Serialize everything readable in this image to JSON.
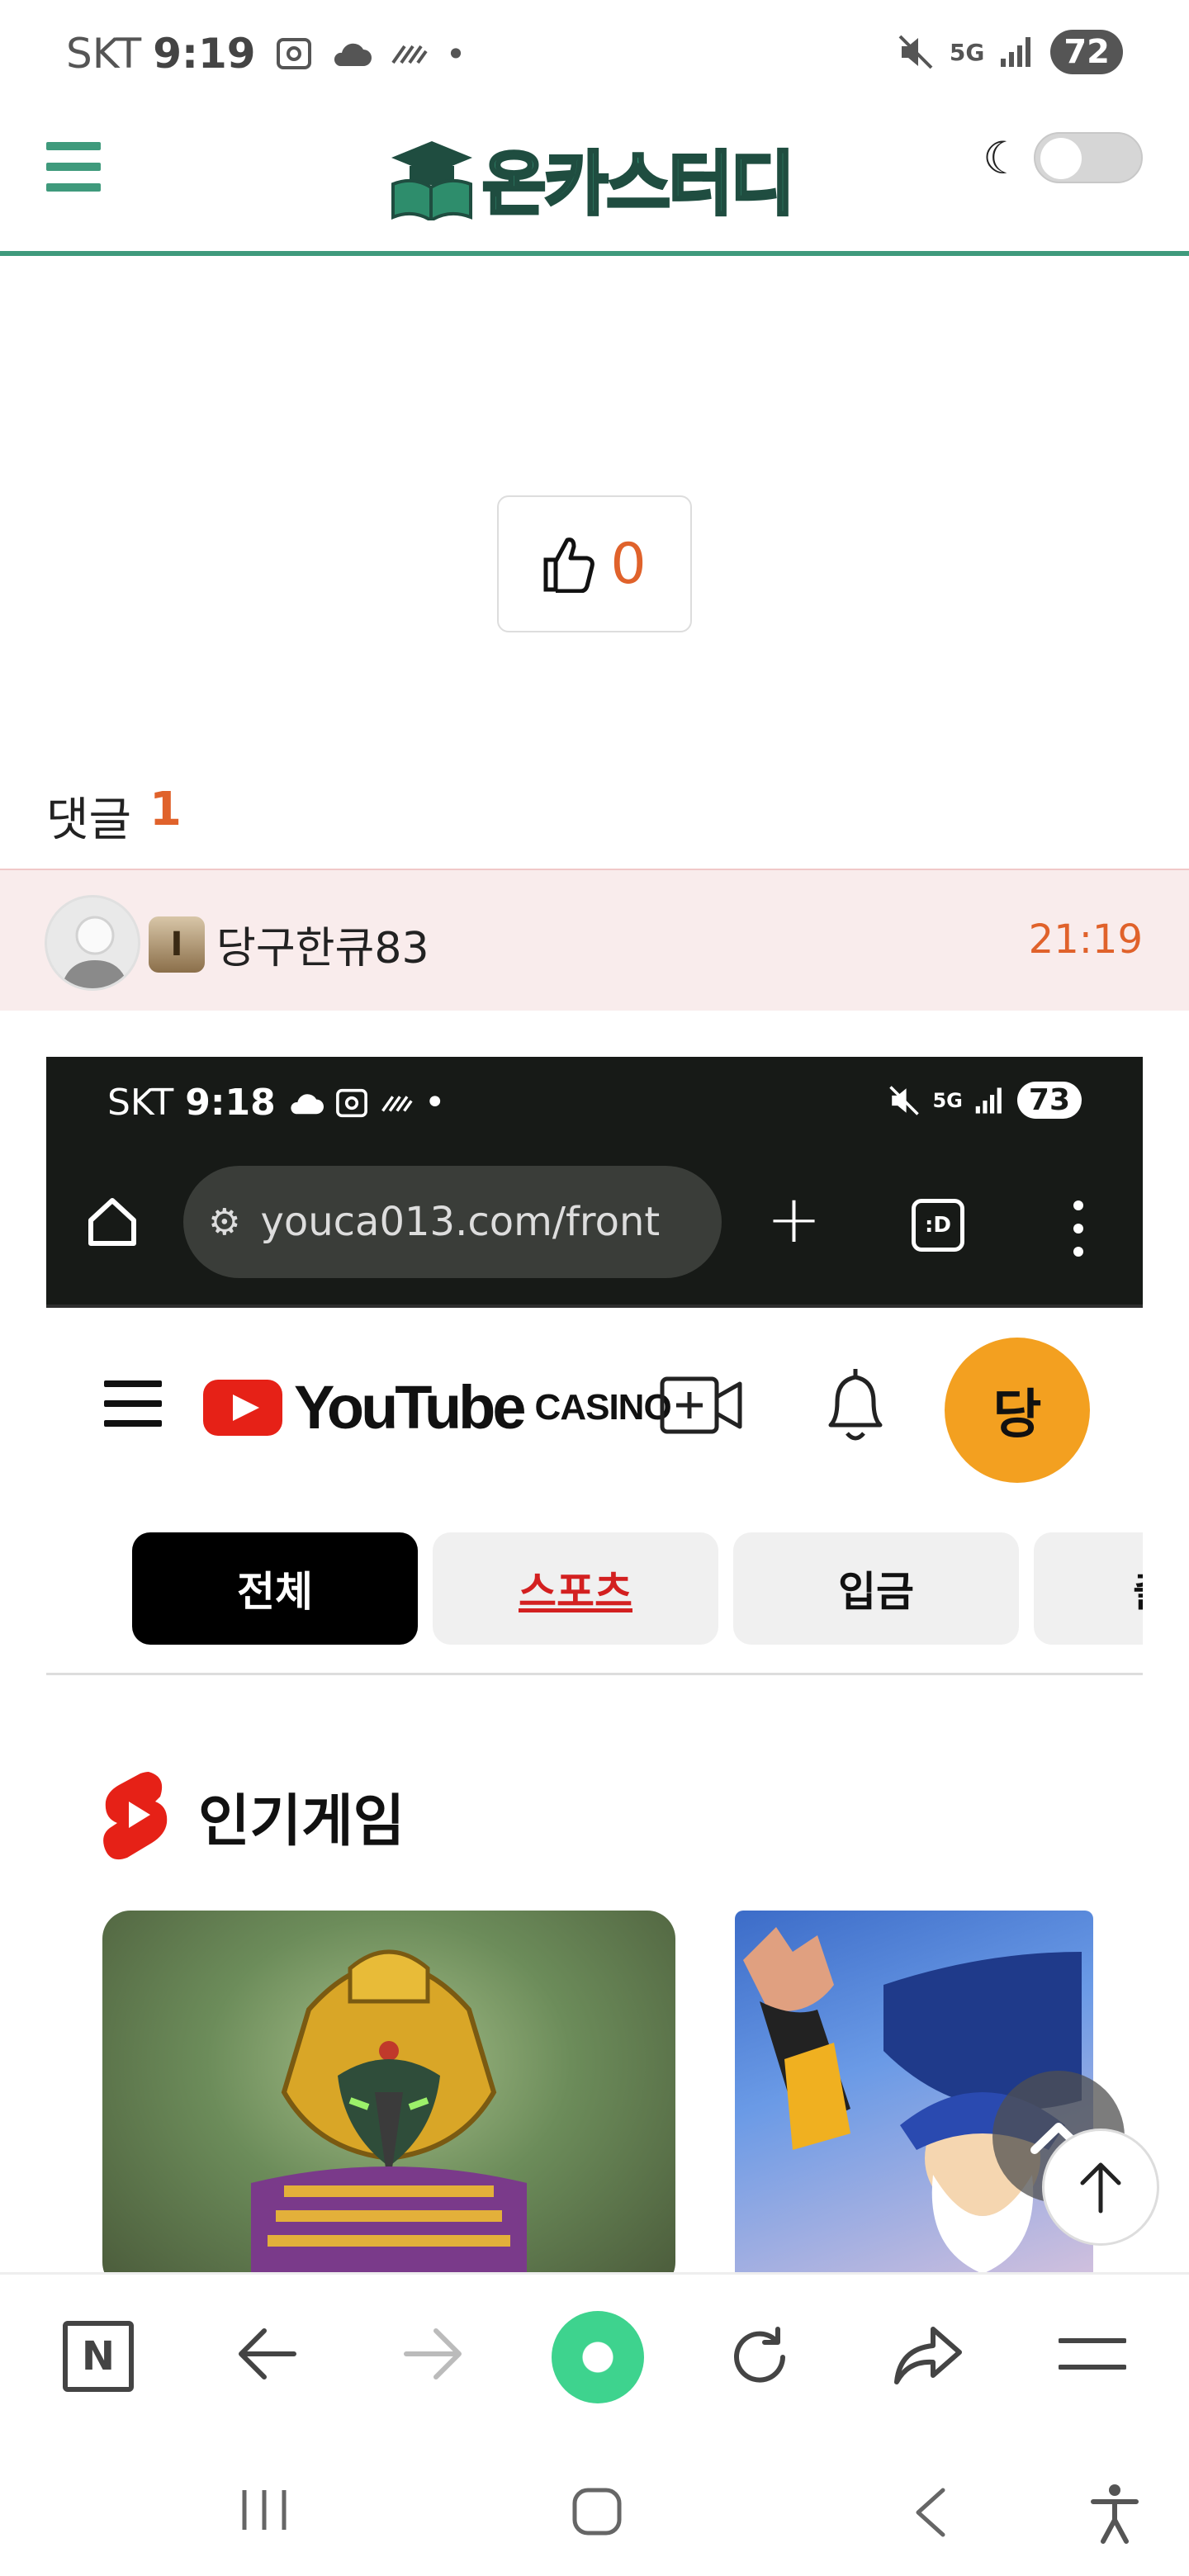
{
  "status": {
    "carrier": "SKT",
    "time": "9:19",
    "network": "5G",
    "battery": "72"
  },
  "header": {
    "site_name": "온카스터디",
    "theme_toggle_on": false
  },
  "like": {
    "count": "0"
  },
  "comments": {
    "heading": "댓글",
    "count": "1",
    "items": [
      {
        "level_badge": "I",
        "username": "당구한큐83",
        "time": "21:19"
      }
    ]
  },
  "embedded": {
    "status": {
      "carrier": "SKT",
      "time": "9:18",
      "network": "5G",
      "battery": "73"
    },
    "url": "youca013.com/front",
    "tabs_label": ":D",
    "brand": {
      "word": "YouTube",
      "suffix": "CASINO"
    },
    "avatar_initial": "당",
    "chips": [
      {
        "label": "전체",
        "state": "active"
      },
      {
        "label": "스포츠",
        "state": "red"
      },
      {
        "label": "입금",
        "state": "normal"
      },
      {
        "label": "출",
        "state": "cut"
      }
    ],
    "section_title": "인기게임"
  },
  "colors": {
    "accent_green": "#3f9a7c",
    "accent_orange": "#e0622b",
    "yt_red": "#e62117",
    "avatar_orange": "#f3a020"
  },
  "icons": {
    "menu": "hamburger-icon",
    "theme": "moon-icon",
    "like": "thumbs-up-icon",
    "browser_toolbar": [
      "naver-icon",
      "back-arrow-icon",
      "forward-arrow-icon",
      "green-circle-icon",
      "refresh-icon",
      "share-icon",
      "menu-lines-icon"
    ],
    "system_nav": [
      "recents-icon",
      "home-icon",
      "back-icon",
      "accessibility-icon"
    ]
  }
}
